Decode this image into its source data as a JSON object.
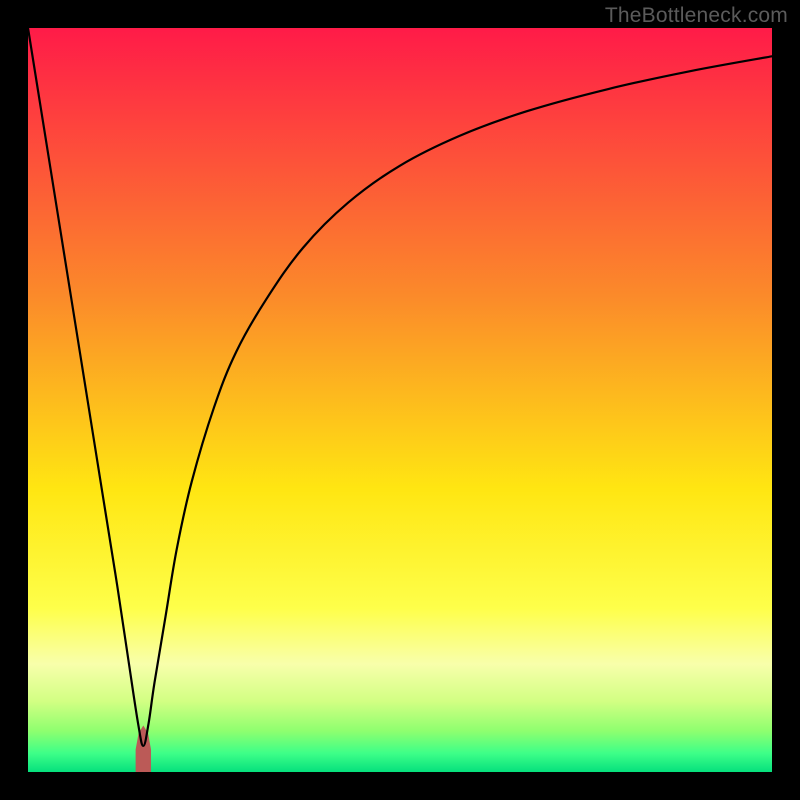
{
  "watermark": "TheBottleneck.com",
  "chart_data": {
    "type": "line",
    "title": "",
    "xlabel": "",
    "ylabel": "",
    "xlim": [
      0,
      100
    ],
    "ylim": [
      0,
      100
    ],
    "grid": false,
    "legend": false,
    "gradient_stops": [
      {
        "offset": 0.0,
        "color": "#ff1b48"
      },
      {
        "offset": 0.36,
        "color": "#fb8a2a"
      },
      {
        "offset": 0.62,
        "color": "#ffe612"
      },
      {
        "offset": 0.78,
        "color": "#feff4a"
      },
      {
        "offset": 0.855,
        "color": "#f8ffab"
      },
      {
        "offset": 0.905,
        "color": "#d2ff83"
      },
      {
        "offset": 0.945,
        "color": "#8eff6f"
      },
      {
        "offset": 0.975,
        "color": "#3dff88"
      },
      {
        "offset": 1.0,
        "color": "#05e07d"
      }
    ],
    "series": [
      {
        "name": "curve-main",
        "x": [
          0,
          2,
          4,
          6,
          8,
          10,
          12,
          13.5,
          14.8,
          15.5,
          16.2,
          17.0,
          18.5,
          20,
          22,
          25,
          28,
          32,
          37,
          43,
          50,
          58,
          67,
          78,
          89,
          100
        ],
        "values": [
          100,
          87.5,
          75,
          62.5,
          50,
          37.5,
          25,
          15,
          6.5,
          3.5,
          6.5,
          12,
          21,
          30,
          39,
          49,
          56.5,
          63.5,
          70.5,
          76.5,
          81.5,
          85.5,
          88.8,
          91.8,
          94.2,
          96.2
        ]
      }
    ],
    "bump": {
      "name": "minimum-marker",
      "x": [
        14.6,
        15.0,
        15.5,
        16.0,
        16.4
      ],
      "values": [
        3.0,
        5.2,
        6.0,
        5.2,
        3.0
      ],
      "color": "#bb5a57"
    }
  }
}
